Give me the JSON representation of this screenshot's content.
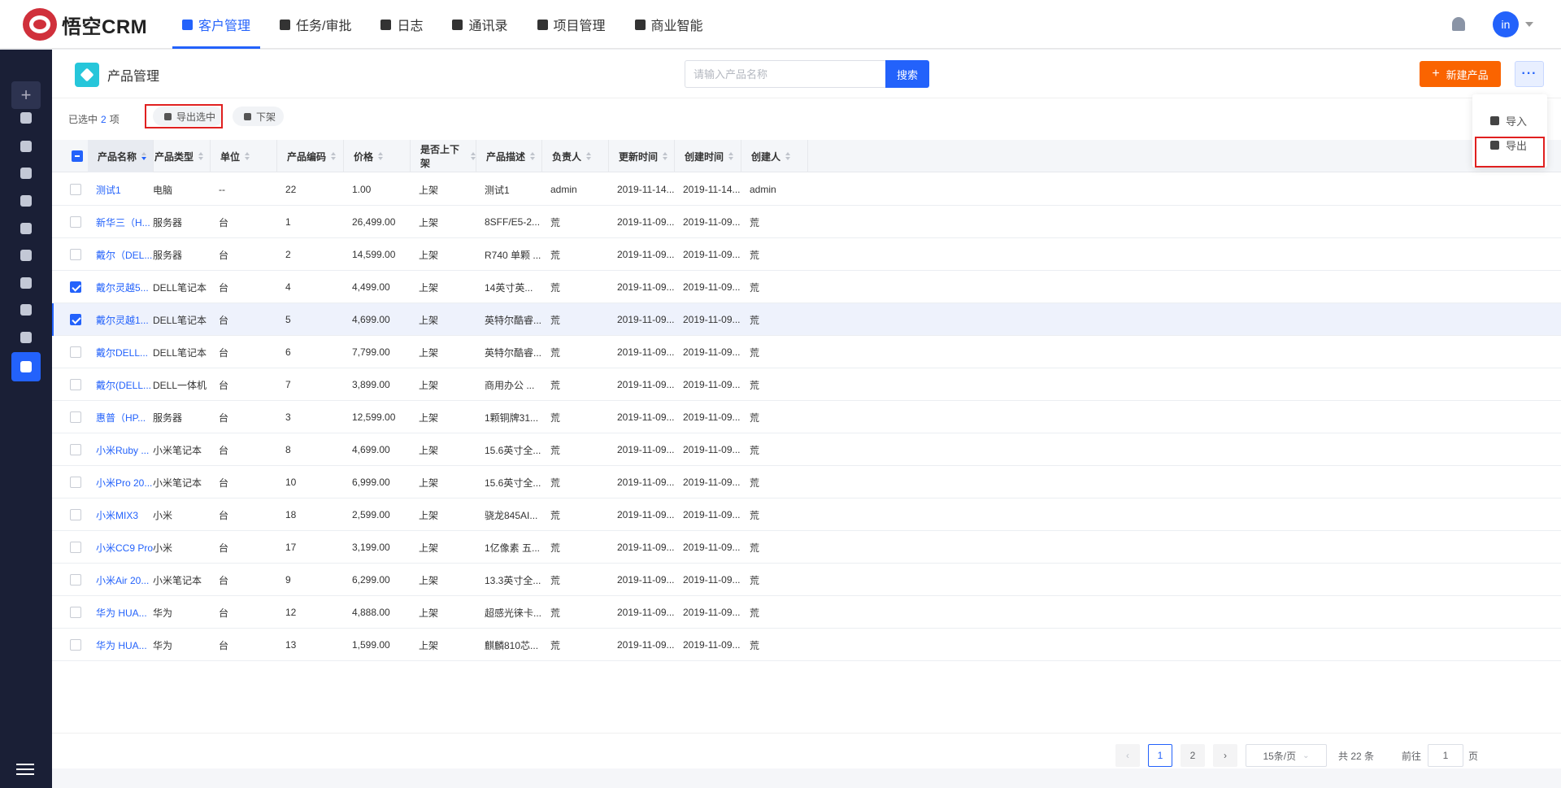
{
  "app": {
    "logo_text": "悟空CRM"
  },
  "nav": [
    {
      "label": "客户管理",
      "icon": "customer-icon",
      "active": true
    },
    {
      "label": "任务/审批",
      "icon": "briefcase-icon",
      "active": false
    },
    {
      "label": "日志",
      "icon": "log-icon",
      "active": false
    },
    {
      "label": "通讯录",
      "icon": "phone-icon",
      "active": false
    },
    {
      "label": "项目管理",
      "icon": "project-icon",
      "active": false
    },
    {
      "label": "商业智能",
      "icon": "bi-icon",
      "active": false
    }
  ],
  "user": {
    "avatar": "in"
  },
  "sidebar": {
    "add": "+",
    "items": [
      "dashboard-icon",
      "message-icon",
      "transfer-icon",
      "building-icon",
      "contact-icon",
      "business-icon",
      "money-icon",
      "contract-icon",
      "moneybag-icon",
      "product-icon"
    ]
  },
  "page": {
    "title": "产品管理",
    "search_placeholder": "请输入产品名称",
    "search_button": "搜索",
    "new_button": "新建产品",
    "more_button": "···"
  },
  "dropdown": {
    "items": [
      "导入",
      "导出"
    ]
  },
  "selection": {
    "prefix": "已选中",
    "count": "2",
    "suffix": "项",
    "export_selected": "导出选中",
    "take_down": "下架"
  },
  "table": {
    "columns": [
      "产品名称",
      "产品类型",
      "单位",
      "产品编码",
      "价格",
      "是否上下架",
      "产品描述",
      "负责人",
      "更新时间",
      "创建时间",
      "创建人"
    ],
    "rows": [
      {
        "checked": false,
        "cells": [
          "测试1",
          "电脑",
          "--",
          "22",
          "1.00",
          "上架",
          "测试1",
          "admin",
          "2019-11-14...",
          "2019-11-14...",
          "admin"
        ]
      },
      {
        "checked": false,
        "cells": [
          "新华三（H...",
          "服务器",
          "台",
          "1",
          "26,499.00",
          "上架",
          "8SFF/E5-2...",
          "荒",
          "2019-11-09...",
          "2019-11-09...",
          "荒"
        ]
      },
      {
        "checked": false,
        "cells": [
          "戴尔（DEL...",
          "服务器",
          "台",
          "2",
          "14,599.00",
          "上架",
          "R740 单颗 ...",
          "荒",
          "2019-11-09...",
          "2019-11-09...",
          "荒"
        ]
      },
      {
        "checked": true,
        "cells": [
          "戴尔灵越5...",
          "DELL笔记本",
          "台",
          "4",
          "4,499.00",
          "上架",
          "14英寸英...",
          "荒",
          "2019-11-09...",
          "2019-11-09...",
          "荒"
        ]
      },
      {
        "checked": true,
        "cells": [
          "戴尔灵越1...",
          "DELL笔记本",
          "台",
          "5",
          "4,699.00",
          "上架",
          "英特尔酷睿...",
          "荒",
          "2019-11-09...",
          "2019-11-09...",
          "荒"
        ]
      },
      {
        "checked": false,
        "cells": [
          "戴尔DELL...",
          "DELL笔记本",
          "台",
          "6",
          "7,799.00",
          "上架",
          "英特尔酷睿...",
          "荒",
          "2019-11-09...",
          "2019-11-09...",
          "荒"
        ]
      },
      {
        "checked": false,
        "cells": [
          "戴尔(DELL...",
          "DELL一体机",
          "台",
          "7",
          "3,899.00",
          "上架",
          "商用办公 ...",
          "荒",
          "2019-11-09...",
          "2019-11-09...",
          "荒"
        ]
      },
      {
        "checked": false,
        "cells": [
          "惠普（HP...",
          "服务器",
          "台",
          "3",
          "12,599.00",
          "上架",
          "1颗铜牌31...",
          "荒",
          "2019-11-09...",
          "2019-11-09...",
          "荒"
        ]
      },
      {
        "checked": false,
        "cells": [
          "小米Ruby ...",
          "小米笔记本",
          "台",
          "8",
          "4,699.00",
          "上架",
          "15.6英寸全...",
          "荒",
          "2019-11-09...",
          "2019-11-09...",
          "荒"
        ]
      },
      {
        "checked": false,
        "cells": [
          "小米Pro 20...",
          "小米笔记本",
          "台",
          "10",
          "6,999.00",
          "上架",
          "15.6英寸全...",
          "荒",
          "2019-11-09...",
          "2019-11-09...",
          "荒"
        ]
      },
      {
        "checked": false,
        "cells": [
          "小米MIX3",
          "小米",
          "台",
          "18",
          "2,599.00",
          "上架",
          "骁龙845AI...",
          "荒",
          "2019-11-09...",
          "2019-11-09...",
          "荒"
        ]
      },
      {
        "checked": false,
        "cells": [
          "小米CC9 Pro",
          "小米",
          "台",
          "17",
          "3,199.00",
          "上架",
          "1亿像素 五...",
          "荒",
          "2019-11-09...",
          "2019-11-09...",
          "荒"
        ]
      },
      {
        "checked": false,
        "cells": [
          "小米Air 20...",
          "小米笔记本",
          "台",
          "9",
          "6,299.00",
          "上架",
          "13.3英寸全...",
          "荒",
          "2019-11-09...",
          "2019-11-09...",
          "荒"
        ]
      },
      {
        "checked": false,
        "cells": [
          "华为 HUA...",
          "华为",
          "台",
          "12",
          "4,888.00",
          "上架",
          "超感光徕卡...",
          "荒",
          "2019-11-09...",
          "2019-11-09...",
          "荒"
        ]
      },
      {
        "checked": false,
        "cells": [
          "华为 HUA...",
          "华为",
          "台",
          "13",
          "1,599.00",
          "上架",
          "麒麟810芯...",
          "荒",
          "2019-11-09...",
          "2019-11-09...",
          "荒"
        ]
      }
    ]
  },
  "pagination": {
    "prev": "‹",
    "next": "›",
    "pages": [
      "1",
      "2"
    ],
    "current": "1",
    "page_size": "15条/页",
    "total": "共 22 条",
    "goto_prefix": "前往",
    "goto_value": "1",
    "goto_suffix": "页"
  },
  "colors": {
    "primary": "#2362fb",
    "orange": "#fa6400",
    "sidebar": "#1a1f36",
    "highlight": "#e02020"
  }
}
